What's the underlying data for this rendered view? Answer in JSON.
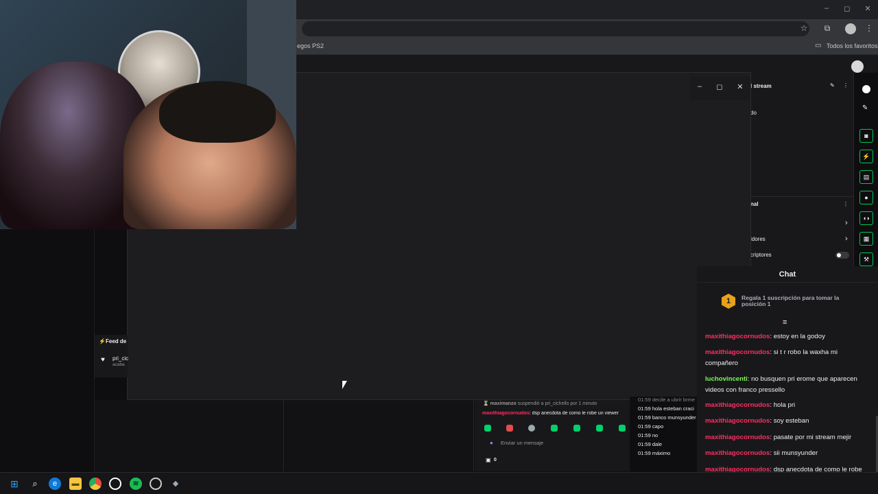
{
  "browser": {
    "bookmark_left": "egos PS2",
    "bookmark_right": "Todos los favoritos",
    "window_controls": [
      "–",
      "◻",
      "✕"
    ]
  },
  "popup": {
    "controls": [
      "–",
      "◻",
      "✕"
    ]
  },
  "right_panel": {
    "title": "l stream",
    "line1": "do",
    "section": "nal",
    "row1": "ldores",
    "row2": "criptores"
  },
  "feed": {
    "title": "Feed de",
    "item_user": "pri_cic",
    "item_sub": "acaba"
  },
  "inner_chat": {
    "mod_note_user": "maximanzo",
    "mod_note_text": "suspendió a pri_cichello por 1 minuto",
    "msg_user": "maxithiagocornudos",
    "msg_text": ": dsp anecdota de como le robe un viewer",
    "input_placeholder": "Enviar un mensaje",
    "points": "0"
  },
  "inner_log": [
    {
      "time": "01:59",
      "text": "decile a ubrir brme"
    },
    {
      "time": "01:59",
      "text": "hola esteban craci"
    },
    {
      "time": "01:59",
      "text": "banco munsyunder"
    },
    {
      "time": "01:59",
      "text": "capo"
    },
    {
      "time": "01:59",
      "text": "no"
    },
    {
      "time": "01:59",
      "text": "dale"
    },
    {
      "time": "01:59",
      "text": "máximo"
    }
  ],
  "chat": {
    "header": "Chat",
    "sub_rank": "1",
    "sub_banner": "Regala 1 suscripción para tomar la posición 1",
    "user_colors": {
      "maxi": "#ff2e63",
      "lucho": "#7cf85a"
    },
    "messages": [
      {
        "user": "maxithiagocornudos",
        "text": ": estoy en la godoy",
        "color": "#ff2e63"
      },
      {
        "user": "maxithiagocornudos",
        "text": ": si t r robo la waxha mi compañero",
        "color": "#ff2e63"
      },
      {
        "user": "luchovincenti",
        "text": ": no busquen pri erome que aparecen videos con franco pressello",
        "color": "#7cf85a"
      },
      {
        "user": "maxithiagocornudos",
        "text": ": hola pri",
        "color": "#ff2e63"
      },
      {
        "user": "maxithiagocornudos",
        "text": ": soy esteban",
        "color": "#ff2e63"
      },
      {
        "user": "maxithiagocornudos",
        "text": ": pasate por mi stream mejir",
        "color": "#ff2e63"
      },
      {
        "user": "maxithiagocornudos",
        "text": ": sii munsyunder",
        "color": "#ff2e63"
      },
      {
        "user": "maxithiagocornudos",
        "text": ": dsp anecdota de como le robe un viewer a maxi",
        "color": "#ff2e63"
      }
    ]
  },
  "taskbar": {
    "icons": [
      "windows-start-icon",
      "search-icon",
      "edge-icon",
      "file-explorer-icon",
      "chrome-icon",
      "whatsapp-icon",
      "spotify-icon",
      "obs-icon",
      "app-icon"
    ]
  }
}
